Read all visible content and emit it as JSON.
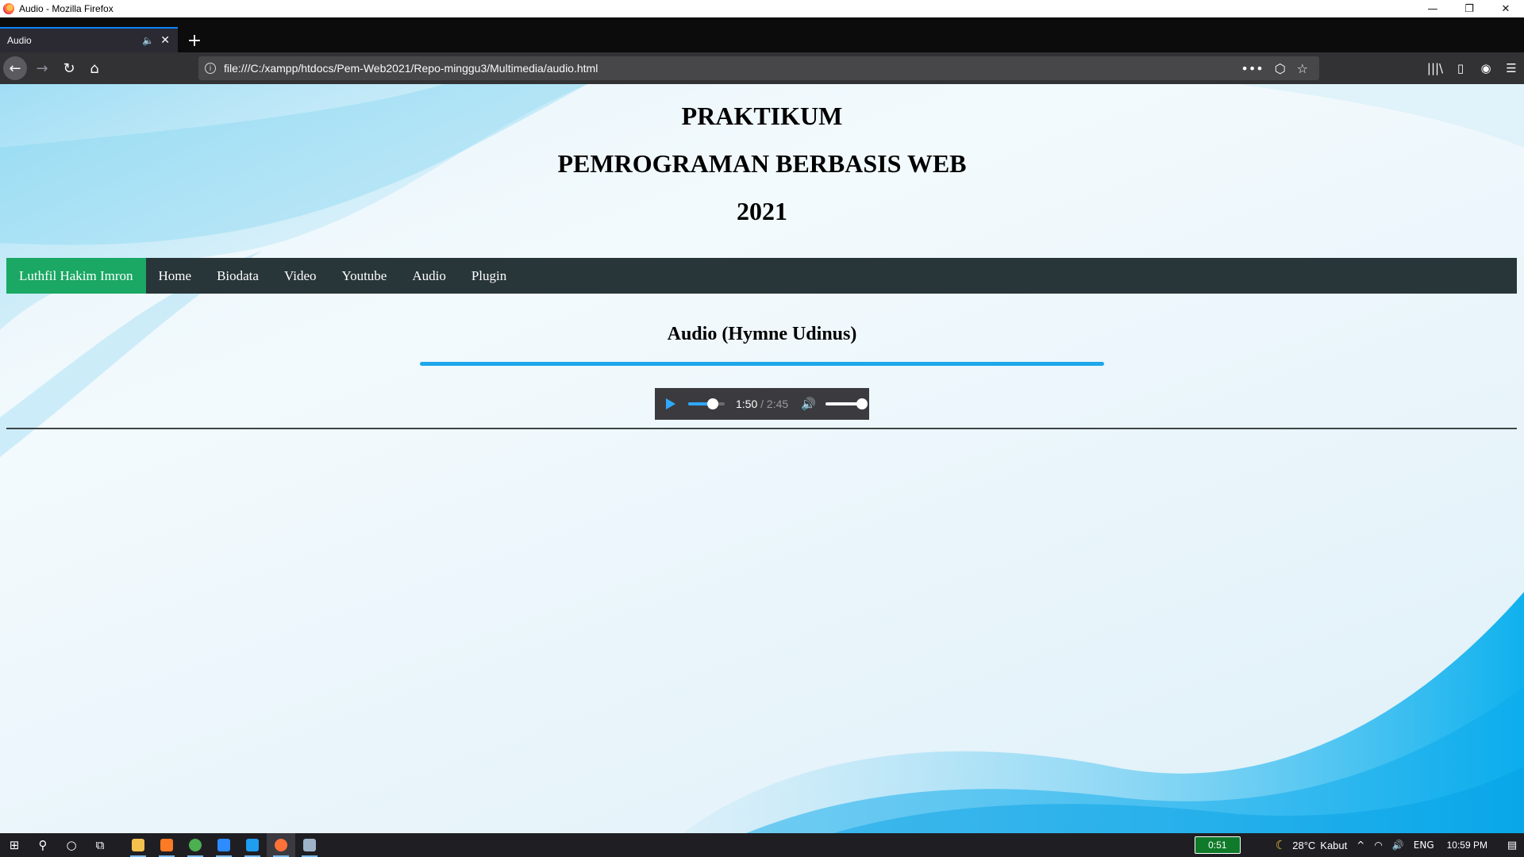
{
  "window": {
    "title": "Audio - Mozilla Firefox",
    "controls": {
      "minimize": "—",
      "restore": "❐",
      "close": "✕"
    }
  },
  "browser": {
    "tab": {
      "label": "Audio",
      "audio_icon": "🔈",
      "close": "✕"
    },
    "new_tab": "+",
    "nav": {
      "back": "←",
      "forward": "→",
      "reload": "↻",
      "home": "⌂"
    },
    "url": "file:///C:/xampp/htdocs/Pem-Web2021/Repo-minggu3/Multimedia/audio.html",
    "url_info": "i",
    "url_actions": {
      "more": "•••",
      "pocket": "⬡",
      "bookmark": "☆"
    },
    "toolbar": {
      "library": "|||\\",
      "sidebar": "▯",
      "account": "◉",
      "menu": "☰"
    }
  },
  "page": {
    "header": {
      "line1": "PRAKTIKUM",
      "line2": "PEMROGRAMAN BERBASIS WEB",
      "line3": "2021"
    },
    "nav": {
      "brand": "Luthfil Hakim Imron",
      "items": [
        "Home",
        "Biodata",
        "Video",
        "Youtube",
        "Audio",
        "Plugin"
      ]
    },
    "section_title": "Audio (Hymne Udinus)",
    "audio": {
      "current": "1:50",
      "duration": " / 2:45",
      "progress_fraction": 0.667,
      "volume_fraction": 1.0,
      "volume_icon": "🔊"
    }
  },
  "taskbar": {
    "start": "⊞",
    "search": "⚲",
    "cortana": "○",
    "taskview": "⧉",
    "apps": [
      {
        "name": "file-explorer",
        "color": "#f2c14e",
        "open": true
      },
      {
        "name": "xampp",
        "color": "#fb7a24",
        "open": true
      },
      {
        "name": "chrome",
        "color": "#4caf50",
        "open": true
      },
      {
        "name": "zoom",
        "color": "#2d8cff",
        "open": true
      },
      {
        "name": "vscode",
        "color": "#1e9df1",
        "open": true
      },
      {
        "name": "firefox",
        "color": "#ff7139",
        "open": true,
        "active": true
      },
      {
        "name": "other-app",
        "color": "#9fb3c8",
        "open": true
      }
    ],
    "battery_timer": "0:51",
    "weather": {
      "icon": "☾",
      "temp": "28°C",
      "desc": "Kabut"
    },
    "tray": {
      "chevron": "^",
      "wifi": "◠",
      "volume": "🔊",
      "lang": "ENG"
    },
    "clock": "10:59 PM",
    "notifications": "▤"
  }
}
